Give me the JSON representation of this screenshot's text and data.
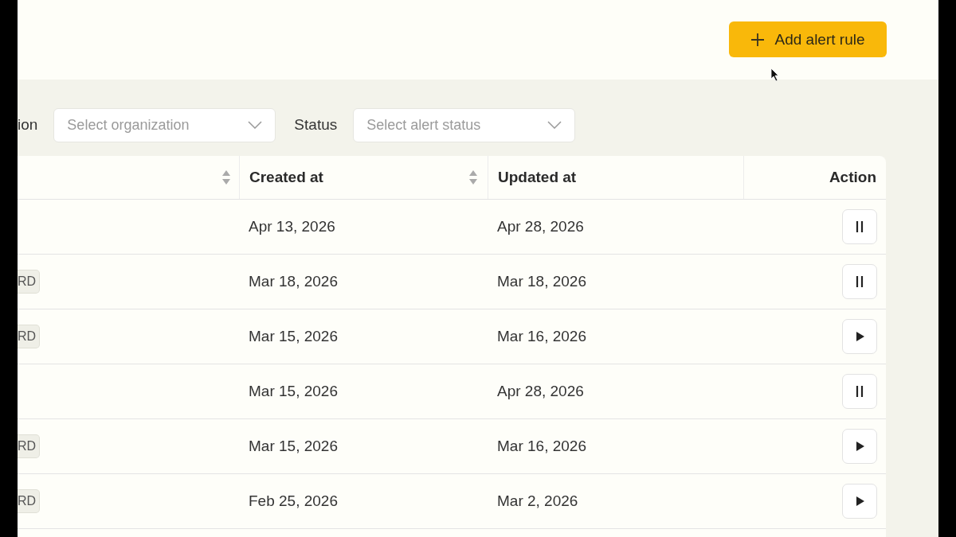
{
  "add_button": {
    "label": "Add alert rule"
  },
  "filters": [
    {
      "label": "ion",
      "placeholder": "Select organization"
    },
    {
      "label": "Status",
      "placeholder": "Select alert status"
    }
  ],
  "table": {
    "columns": [
      {
        "sortable": true
      },
      {
        "label": "Created at",
        "sortable": true
      },
      {
        "label": "Updated at",
        "sortable": false
      },
      {
        "label": "Action",
        "sortable": false
      }
    ],
    "rows": [
      {
        "created": "Apr 13, 2026",
        "updated": "Apr 28, 2026",
        "action": {
          "kind": "pause"
        }
      },
      {
        "tag": "RD",
        "created": "Mar 18, 2026",
        "updated": "Mar 18, 2026",
        "action": {
          "kind": "pause"
        }
      },
      {
        "tag": "RD",
        "created": "Mar 15, 2026",
        "updated": "Mar 16, 2026",
        "action": {
          "kind": "play"
        }
      },
      {
        "created": "Mar 15, 2026",
        "updated": "Apr 28, 2026",
        "action": {
          "kind": "pause"
        }
      },
      {
        "tag": "RD",
        "created": "Mar 15, 2026",
        "updated": "Mar 16, 2026",
        "action": {
          "kind": "play"
        }
      },
      {
        "tag": "RD",
        "created": "Feb 25, 2026",
        "updated": "Mar 2, 2026",
        "action": {
          "kind": "play"
        }
      }
    ]
  }
}
